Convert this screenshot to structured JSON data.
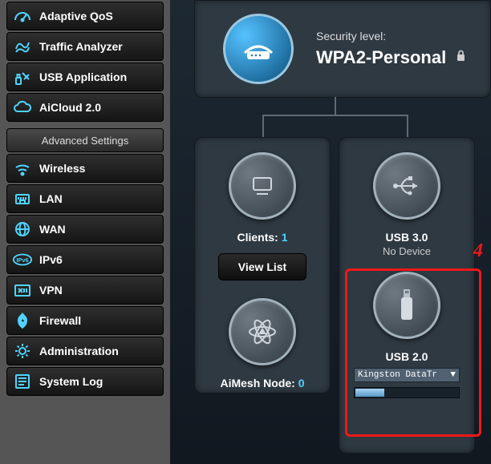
{
  "sidebar": {
    "general_items": [
      {
        "label": "Adaptive QoS",
        "icon": "dashboard-icon"
      },
      {
        "label": "Traffic Analyzer",
        "icon": "traffic-icon"
      },
      {
        "label": "USB Application",
        "icon": "usb-app-icon"
      },
      {
        "label": "AiCloud 2.0",
        "icon": "cloud-icon"
      }
    ],
    "advanced_header": "Advanced Settings",
    "advanced_items": [
      {
        "label": "Wireless",
        "icon": "wireless-icon"
      },
      {
        "label": "LAN",
        "icon": "lan-icon"
      },
      {
        "label": "WAN",
        "icon": "wan-icon"
      },
      {
        "label": "IPv6",
        "icon": "ipv6-icon"
      },
      {
        "label": "VPN",
        "icon": "vpn-icon"
      },
      {
        "label": "Firewall",
        "icon": "firewall-icon"
      },
      {
        "label": "Administration",
        "icon": "admin-icon"
      },
      {
        "label": "System Log",
        "icon": "syslog-icon"
      }
    ]
  },
  "security": {
    "label": "Security level:",
    "value": "WPA2-Personal"
  },
  "clients": {
    "label": "Clients:",
    "count": "1",
    "viewlist": "View List"
  },
  "aimesh": {
    "label": "AiMesh Node:",
    "count": "0"
  },
  "usb30": {
    "label": "USB 3.0",
    "status": "No Device"
  },
  "usb20": {
    "label": "USB 2.0",
    "device": "Kingston DataTr"
  },
  "highlight_number": "4"
}
